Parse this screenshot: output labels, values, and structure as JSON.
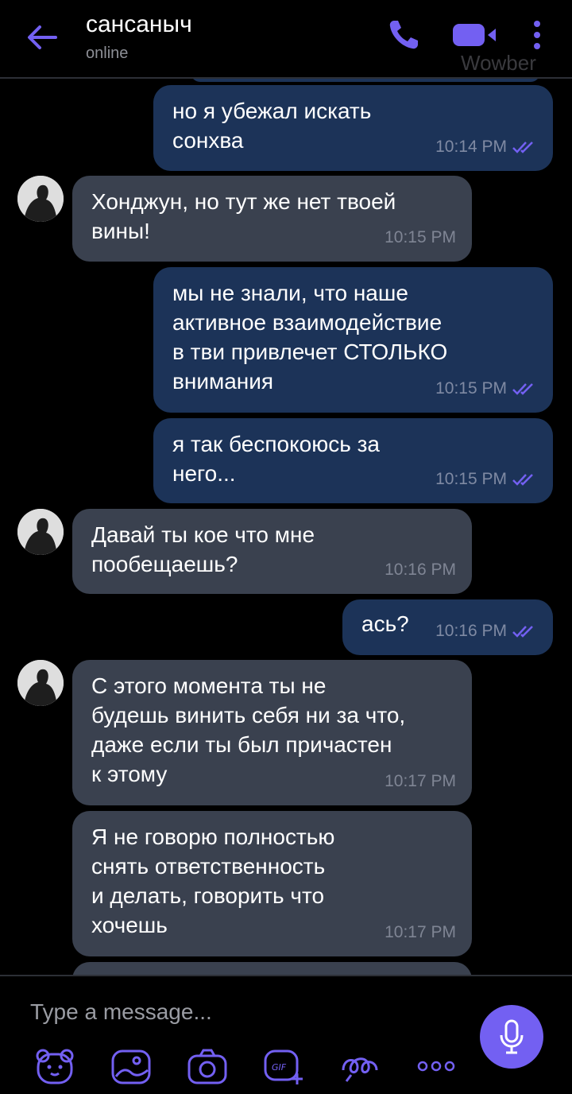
{
  "header": {
    "contact_name": "сансаныч",
    "status": "online",
    "watermark": "Wowber"
  },
  "messages": [
    {
      "direction": "out",
      "text": "но я убежал искать\nсонхва",
      "time": "10:14 PM",
      "read": true
    },
    {
      "direction": "in",
      "text": "Хонджун, но тут же нет твоей\nвины!",
      "time": "10:15 PM"
    },
    {
      "direction": "out",
      "text": "мы не знали, что наше\nактивное взаимодействие\nв тви привлечет СТОЛЬКО\nвнимания",
      "time": "10:15 PM",
      "read": true
    },
    {
      "direction": "out",
      "text": "я так беспокоюсь за\nнего...",
      "time": "10:15 PM",
      "read": true
    },
    {
      "direction": "in",
      "text": "Давай ты кое что мне\nпообещаешь?",
      "time": "10:16 PM"
    },
    {
      "direction": "out",
      "text": "ась?",
      "time": "10:16 PM",
      "read": true
    },
    {
      "direction": "in",
      "text": "С этого момента ты не\nбудешь винить себя ни за что,\nдаже если ты был причастен\nк этому",
      "time": "10:17 PM"
    },
    {
      "direction": "in",
      "text": "Я не говорю полностью\nснять ответственность\nи делать, говорить что\nхочешь",
      "time": "10:17 PM"
    }
  ],
  "composer": {
    "placeholder": "Type a message...",
    "toolbar_icons": [
      "sticker-bear-icon",
      "doodle-icon",
      "camera-icon",
      "gif-icon",
      "sketch-icon",
      "more-dots-icon"
    ]
  },
  "colors": {
    "accent": "#7360f2",
    "outgoing_bubble": "#1c3358",
    "incoming_bubble": "#3a414f",
    "background": "#000000"
  }
}
